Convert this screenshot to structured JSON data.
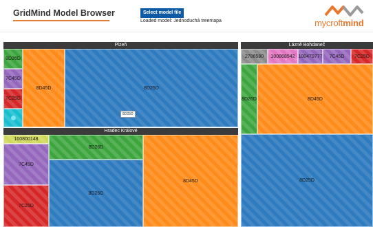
{
  "header": {
    "app_title": "GridMind Model Browser",
    "select_button": "Select model file",
    "loaded_label": "Loaded model: Jednoduchá treemapa",
    "logo_text_a": "mycroft",
    "logo_text_b": "mind",
    "logo_icon": "mm-wave-logo-icon"
  },
  "treemap": {
    "groups": {
      "plzen": "Plzeň",
      "lazne": "Lázně Bohdaneč",
      "hradec": "Hradec Králové"
    },
    "cells": {
      "p_8d26d": "8D26D",
      "p_7c45d": "7C45D",
      "p_7c25d": "7C25D",
      "p_8d45d": "8D45D",
      "p_8d25d": "8D25D",
      "p_tooltip": "8D25D",
      "l_2786580": "2786580",
      "l_100868542": "100868542",
      "l_100479777": "100479777",
      "l_7c45d": "7C45D",
      "l_7c25d": "7C25D",
      "l_8d26d": "8D26D",
      "l_8d45d": "8D45D",
      "h_100800148": "100800148",
      "h_7c45d": "7C45D",
      "h_7c25d": "7C25D",
      "h_8d26d_top": "8D26D",
      "h_8d26d_mid": "8D26D",
      "h_8d45d": "8D45D",
      "r_8d25d": "8D25D"
    }
  },
  "colors": {
    "blue": "#2f7bbf",
    "orange": "#ff8c1a",
    "green": "#3da53d",
    "purple": "#9467bd",
    "red": "#d62728",
    "pink": "#e377c2",
    "lime": "#cfd85a",
    "accent": "#e8782e",
    "button": "#0f5aa5"
  }
}
